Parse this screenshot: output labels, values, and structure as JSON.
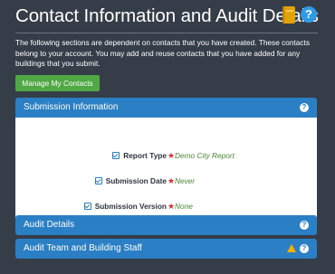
{
  "header": {
    "title": "Contact Information and Audit Details",
    "icons": [
      "book-icon",
      "help-icon"
    ],
    "help_symbol": "?"
  },
  "intro_text": "The following sections are dependent on contacts that you have created. These contacts belong to your account. You may add and reuse contacts that you have added for any buildings that you submit.",
  "manage_button_label": "Manage My Contacts",
  "panels": [
    {
      "title": "Submission Information",
      "expanded": true,
      "fields": [
        {
          "label": "Report Type",
          "value": "Demo City Report",
          "required": true
        },
        {
          "label": "Submission Date",
          "value": "Never",
          "required": true
        },
        {
          "label": "Submission Version",
          "value": "None",
          "required": true
        }
      ]
    },
    {
      "title": "Audit Details",
      "expanded": false
    },
    {
      "title": "Audit Team and Building Staff",
      "expanded": false,
      "warning": true
    }
  ],
  "required_marker": "★",
  "colors": {
    "background": "#353d48",
    "panel_header": "#2b7fc5",
    "button": "#4fa844",
    "value_text": "#4a8a34",
    "required": "#d0312d",
    "warning": "#f2b300"
  }
}
